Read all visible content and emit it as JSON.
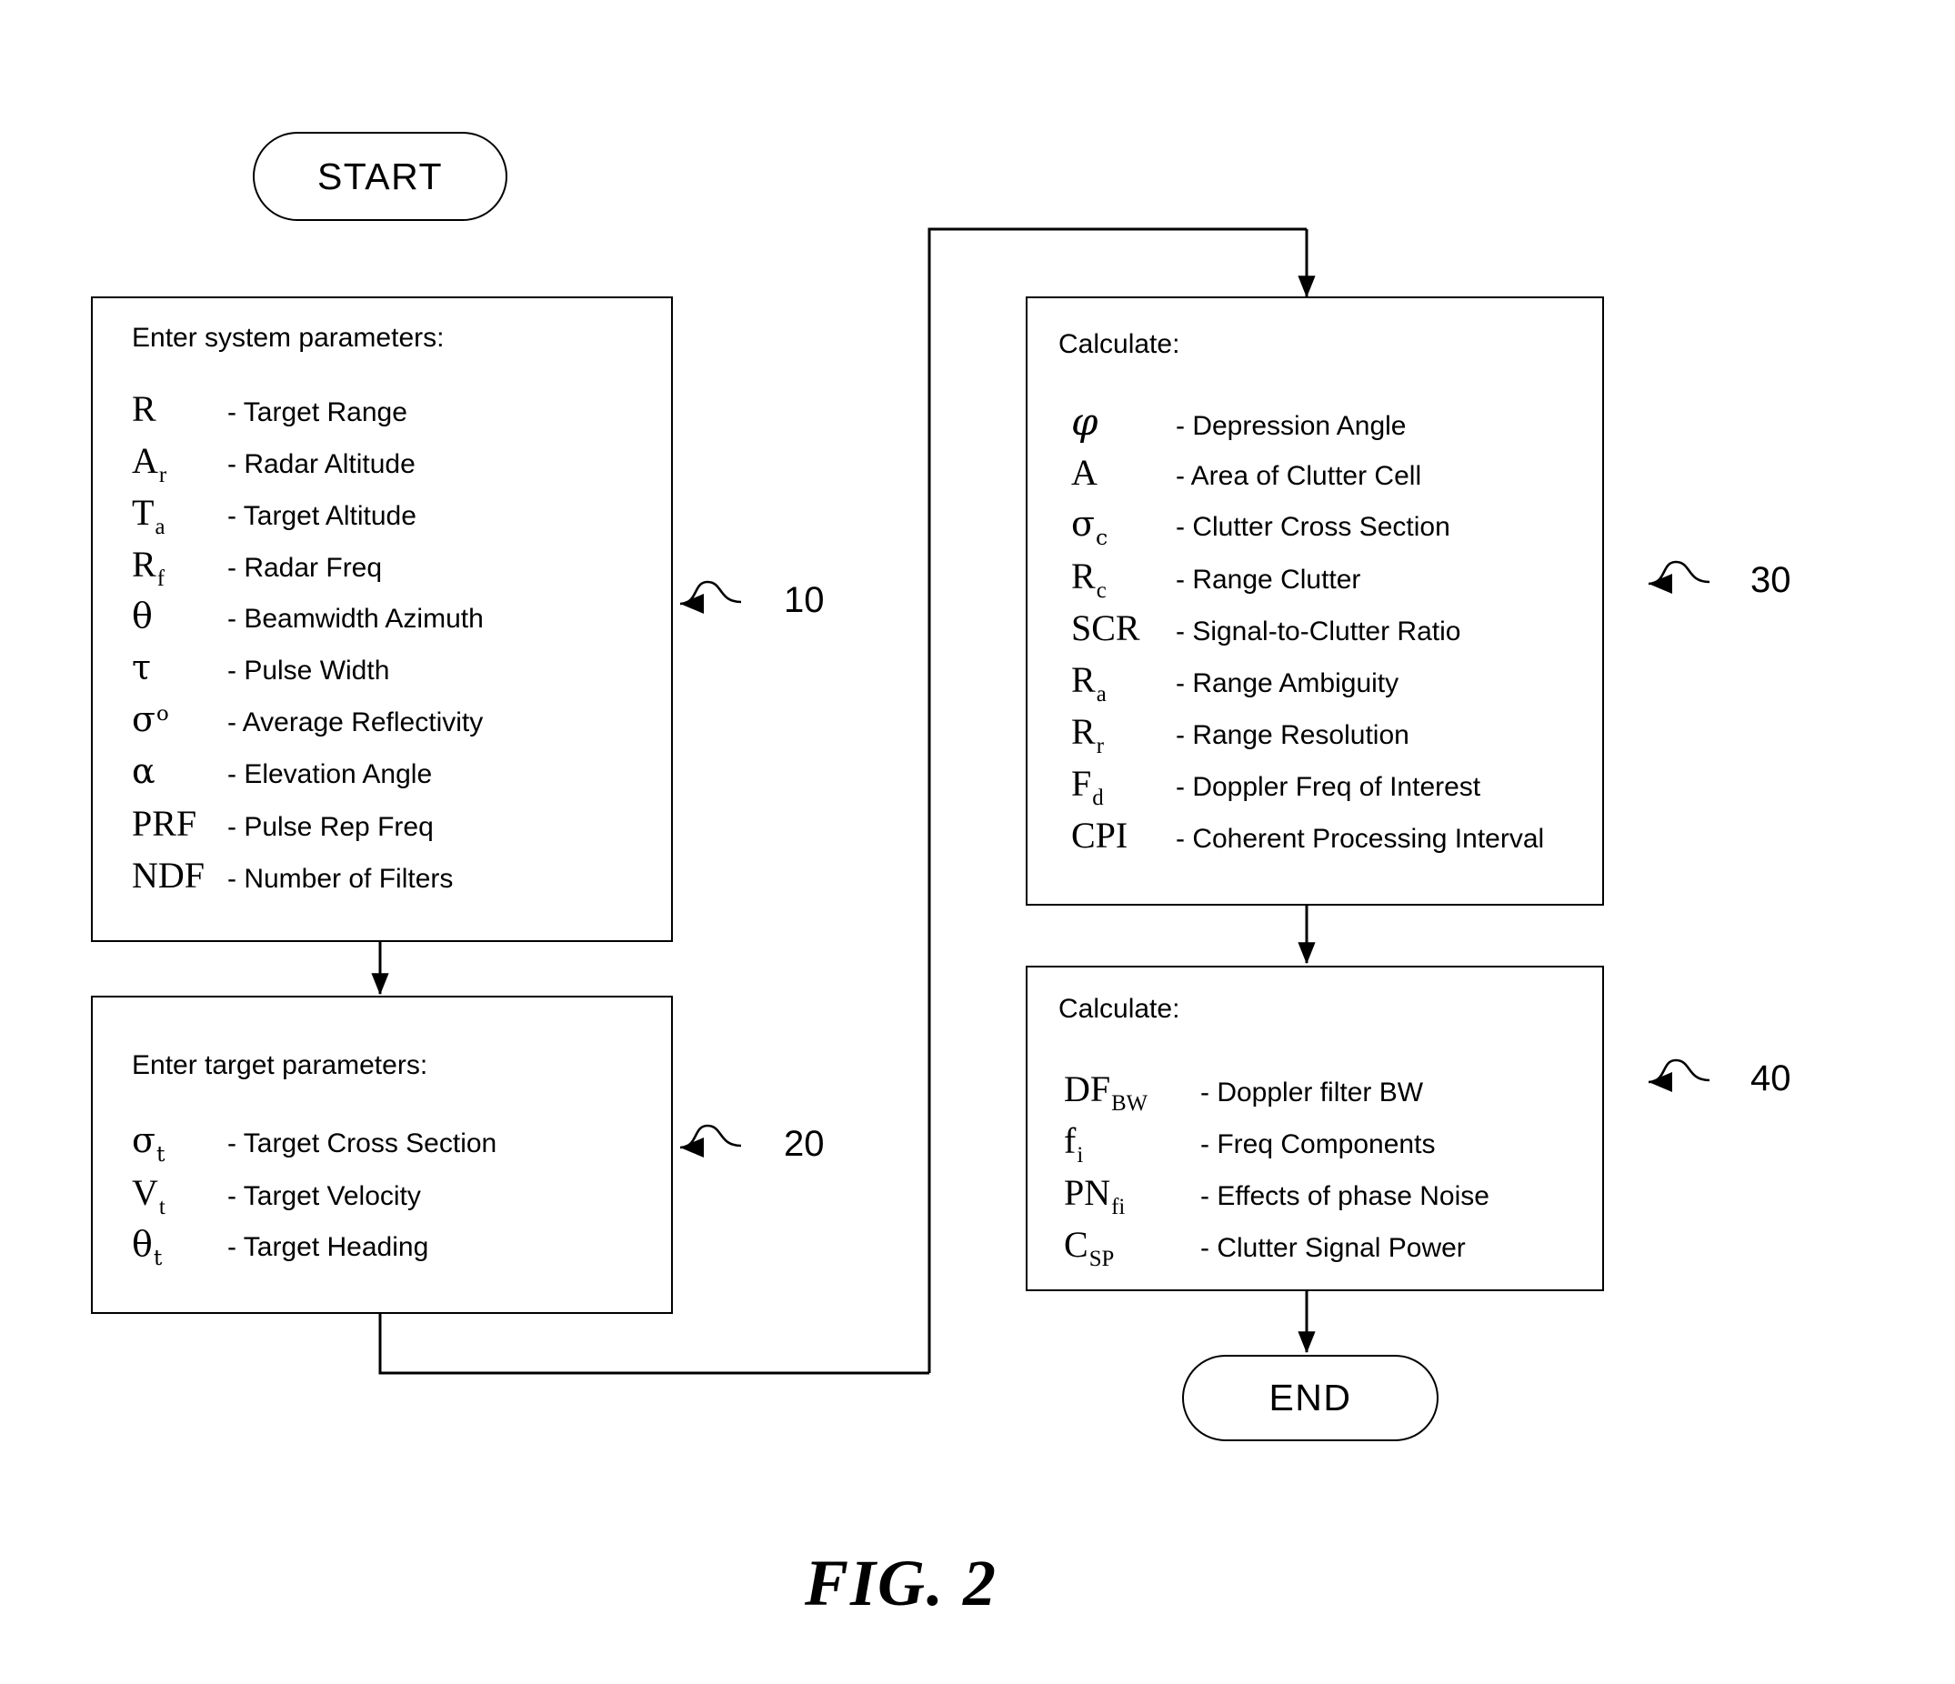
{
  "figure": {
    "caption": "FIG. 2"
  },
  "terminators": {
    "start": "START",
    "end": "END"
  },
  "boxes": [
    {
      "ref": "10",
      "title": "Enter system parameters:",
      "rows": [
        {
          "symbol": "R",
          "sub": "",
          "sup": "",
          "desc": "- Target Range"
        },
        {
          "symbol": "A",
          "sub": "r",
          "sup": "",
          "desc": "- Radar Altitude"
        },
        {
          "symbol": "T",
          "sub": "a",
          "sup": "",
          "desc": "- Target Altitude"
        },
        {
          "symbol": "R",
          "sub": "f",
          "sup": "",
          "desc": "- Radar Freq"
        },
        {
          "symbol": "θ",
          "sub": "",
          "sup": "",
          "desc": "- Beamwidth Azimuth"
        },
        {
          "symbol": "τ",
          "sub": "",
          "sup": "",
          "desc": "- Pulse Width"
        },
        {
          "symbol": "σ",
          "sub": "",
          "sup": "o",
          "desc": "- Average Reflectivity"
        },
        {
          "symbol": "α",
          "sub": "",
          "sup": "",
          "desc": "- Elevation Angle"
        },
        {
          "symbol": "PRF",
          "sub": "",
          "sup": "",
          "desc": "- Pulse Rep Freq"
        },
        {
          "symbol": "NDF",
          "sub": "",
          "sup": "",
          "desc": "- Number of Filters"
        }
      ]
    },
    {
      "ref": "20",
      "title": "Enter target parameters:",
      "rows": [
        {
          "symbol": "σ",
          "sub": "t",
          "sup": "",
          "desc": "- Target Cross Section"
        },
        {
          "symbol": "V",
          "sub": "t",
          "sup": "",
          "desc": "- Target Velocity"
        },
        {
          "symbol": "θ",
          "sub": "t",
          "sup": "",
          "desc": "- Target Heading"
        }
      ]
    },
    {
      "ref": "30",
      "title": "Calculate:",
      "rows": [
        {
          "symbol": "φ",
          "sub": "",
          "sup": "",
          "desc": "- Depression Angle"
        },
        {
          "symbol": "A",
          "sub": "",
          "sup": "",
          "desc": "- Area of Clutter Cell"
        },
        {
          "symbol": "σ",
          "sub": "c",
          "sup": "",
          "desc": "- Clutter Cross Section"
        },
        {
          "symbol": "R",
          "sub": "c",
          "sup": "",
          "desc": "- Range Clutter"
        },
        {
          "symbol": "SCR",
          "sub": "",
          "sup": "",
          "desc": "- Signal-to-Clutter Ratio"
        },
        {
          "symbol": "R",
          "sub": "a",
          "sup": "",
          "desc": "- Range Ambiguity"
        },
        {
          "symbol": "R",
          "sub": "r",
          "sup": "",
          "desc": "- Range Resolution"
        },
        {
          "symbol": "F",
          "sub": "d",
          "sup": "",
          "desc": "- Doppler Freq of Interest"
        },
        {
          "symbol": "CPI",
          "sub": "",
          "sup": "",
          "desc": "- Coherent Processing Interval"
        }
      ]
    },
    {
      "ref": "40",
      "title": "Calculate:",
      "rows": [
        {
          "symbol": "DF",
          "sub": "BW",
          "sup": "",
          "desc": "- Doppler filter BW"
        },
        {
          "symbol": "f",
          "sub": "i",
          "sup": "",
          "desc": "- Freq Components"
        },
        {
          "symbol": "PN",
          "sub": "fi",
          "sup": "",
          "desc": "- Effects of phase Noise"
        },
        {
          "symbol": "C",
          "sub": "SP",
          "sup": "",
          "desc": "- Clutter Signal Power"
        }
      ]
    }
  ],
  "colors": {
    "stroke": "#000000",
    "background": "#ffffff"
  }
}
